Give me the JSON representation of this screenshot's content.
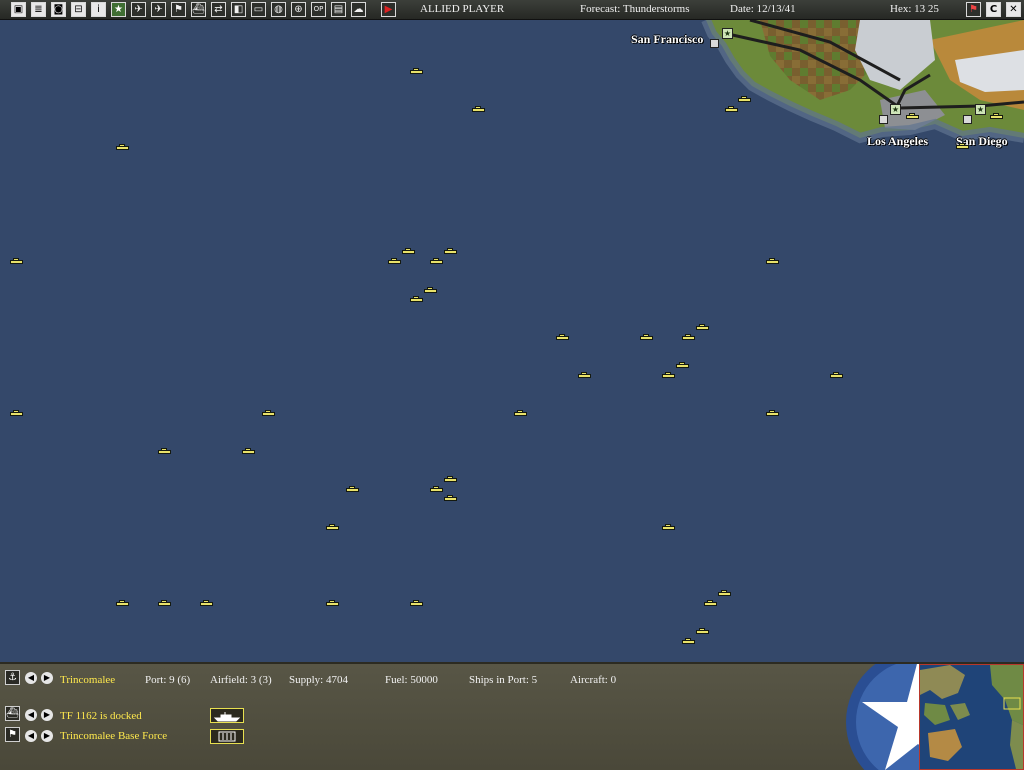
{
  "toolbar": {
    "player": "ALLIED PLAYER",
    "forecast": "Forecast: Thunderstorms",
    "date": "Date: 12/13/41",
    "hex": "Hex: 13 25",
    "button_right_c": "C",
    "button_op": "OP"
  },
  "map": {
    "cities": {
      "san_francisco": "San Francisco",
      "los_angeles": "Los Angeles",
      "san_diego": "San Diego"
    },
    "colors": {
      "ocean": "#34486a",
      "ship": "#e8e26a"
    }
  },
  "panel": {
    "base_name": "Trincomalee",
    "port": "Port: 9 (6)",
    "airfield": "Airfield: 3 (3)",
    "supply": "Supply: 4704",
    "fuel": "Fuel: 50000",
    "ships_in_port": "Ships in Port: 5",
    "aircraft": "Aircraft: 0",
    "task_force": "TF 1162 is docked",
    "base_force": "Trincomalee Base Force"
  }
}
